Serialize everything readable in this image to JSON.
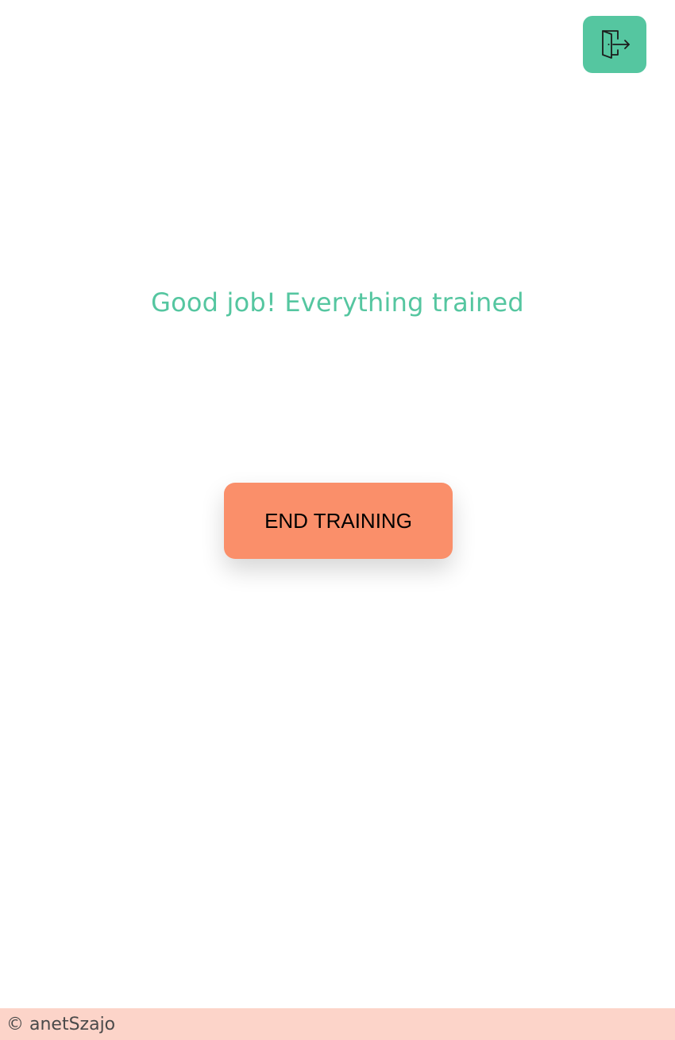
{
  "header": {
    "logout_icon": "door-exit-icon"
  },
  "main": {
    "message": "Good job! Everything trained",
    "end_button_label": "END TRAINING"
  },
  "footer": {
    "copyright": "© anetSzajo"
  },
  "colors": {
    "accent": "#55c6a0",
    "button": "#fa8f6a",
    "footer_bg": "#fcd4c9"
  }
}
